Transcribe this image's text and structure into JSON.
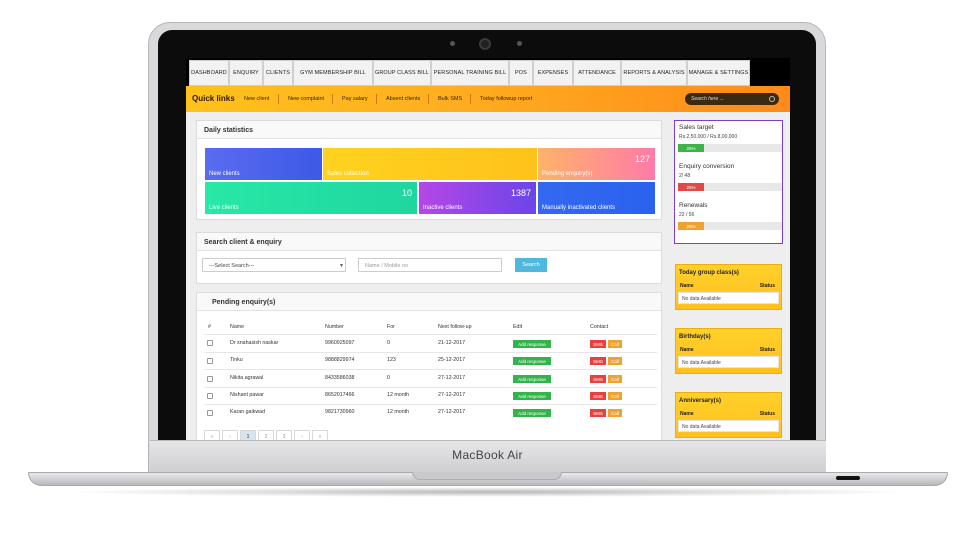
{
  "device": {
    "brand_label": "MacBook Air"
  },
  "nav": {
    "tabs": [
      "DASHBOARD",
      "ENQUIRY",
      "CLIENTS",
      "GYM MEMBERSHIP BILL",
      "GROUP CLASS BILL",
      "PERSONAL TRAINING BILL",
      "POS",
      "EXPENSES",
      "ATTENDANCE",
      "REPORTS & ANALYSIS",
      "MANAGE & SETTINGS"
    ]
  },
  "quick_links": {
    "title": "Quick links",
    "links": [
      "New client",
      "New complaint",
      "Pay salary",
      "Absent clients",
      "Bulk SMS",
      "Today followup report"
    ],
    "search_placeholder": "Search here ..."
  },
  "daily_statistics": {
    "title": "Daily statistics",
    "tiles": [
      {
        "label": "New clients",
        "value": "",
        "color_from": "#5a6cf0",
        "color_to": "#3d59e6"
      },
      {
        "label": "Sales collection",
        "value": "",
        "color_from": "#ffd21f",
        "color_to": "#ffc21a"
      },
      {
        "label": "Pending enquiry(s)",
        "value": "127",
        "color_from": "#ffb36a",
        "color_to": "#ff7aa8"
      },
      {
        "label": "Live clients",
        "value": "10",
        "color_from": "#28e8a6",
        "color_to": "#1fd6a0"
      },
      {
        "label": "Inactive clients",
        "value": "1387",
        "color_from": "#b547e6",
        "color_to": "#6a46e8"
      },
      {
        "label": "Manually inactivated clients",
        "value": "",
        "color_from": "#3568f0",
        "color_to": "#2a62ee"
      }
    ]
  },
  "search_panel": {
    "title": "Search client & enquiry",
    "select_value": "---Select Search---",
    "input_placeholder": "Name / Mobile no",
    "button_label": "Search"
  },
  "pending": {
    "title": "Pending enquiry(s)",
    "columns": [
      "#",
      "Name",
      "Number",
      "For",
      "Next follow-up",
      "Edit",
      "Contact"
    ],
    "rows": [
      {
        "name": "Dr snahasish naskar",
        "number": "9960925097",
        "for": "0",
        "next": "21-12-2017"
      },
      {
        "name": "Tinku",
        "number": "9888829974",
        "for": "123",
        "next": "25-12-2017"
      },
      {
        "name": "Nikita agrawal",
        "number": "8433586038",
        "for": "0",
        "next": "27-12-2017"
      },
      {
        "name": "Nishant pawar",
        "number": "8652017466",
        "for": "12 month",
        "next": "27-12-2017"
      },
      {
        "name": "Karan gaikwad",
        "number": "9821730960",
        "for": "12 month",
        "next": "27-12-2017"
      }
    ],
    "add_label": "Add response",
    "sms_label": "SMS",
    "call_label": "Call",
    "pagination": [
      "«",
      "‹",
      "1",
      "2",
      "3",
      "›",
      "»"
    ]
  },
  "targets": {
    "items": [
      {
        "label": "Sales target",
        "sub": "Rs.2,50,000 / Rs.8,00,000",
        "percent": "25%",
        "fraction": 0.25,
        "color": "#3fb24a"
      },
      {
        "label": "Enquiry conversion",
        "sub": "2/ 48",
        "percent": "25%",
        "fraction": 0.25,
        "color": "#e04a45"
      },
      {
        "label": "Renewals",
        "sub": "22 / 56",
        "percent": "25%",
        "fraction": 0.25,
        "color": "#f0a132"
      }
    ],
    "border_color": "#7a3fd0"
  },
  "side_cards": [
    {
      "title": "Today group class(s)",
      "col1": "Name",
      "col2": "Status",
      "empty": "No data Available"
    },
    {
      "title": "Birthday(s)",
      "col1": "Name",
      "col2": "Status",
      "empty": "No data Available"
    },
    {
      "title": "Anniversary(s)",
      "col1": "Name",
      "col2": "Status",
      "empty": "No data Available"
    }
  ]
}
